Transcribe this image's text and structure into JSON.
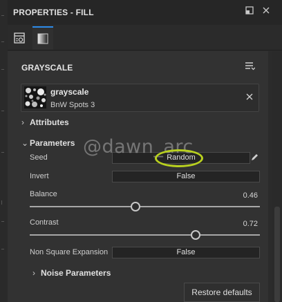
{
  "panel": {
    "title": "PROPERTIES - FILL"
  },
  "titlebar": {
    "dock_icon": "dock-icon",
    "close_icon": "close-icon"
  },
  "tabs": [
    {
      "icon": "properties-settings-icon",
      "active": false
    },
    {
      "icon": "gradient-square-icon",
      "active": true
    }
  ],
  "section": {
    "title": "GRAYSCALE",
    "menu_icon": "list-menu-icon"
  },
  "preset": {
    "name": "grayscale",
    "sub": "BnW Spots 3"
  },
  "groups": {
    "attributes": "Attributes",
    "parameters": "Parameters",
    "noise": "Noise Parameters"
  },
  "params": {
    "seed": {
      "label": "Seed",
      "value": "Random"
    },
    "invert": {
      "label": "Invert",
      "value": "False"
    },
    "balance": {
      "label": "Balance",
      "value": "0.46",
      "level": 0.46
    },
    "contrast": {
      "label": "Contrast",
      "value": "0.72",
      "level": 0.72
    },
    "non_square": {
      "label": "Non Square Expansion",
      "value": "False"
    }
  },
  "restore_label": "Restore defaults",
  "watermark": "@dawn_arc",
  "colors": {
    "accent": "#2d8ceb",
    "highlight": "#b9d11f"
  }
}
